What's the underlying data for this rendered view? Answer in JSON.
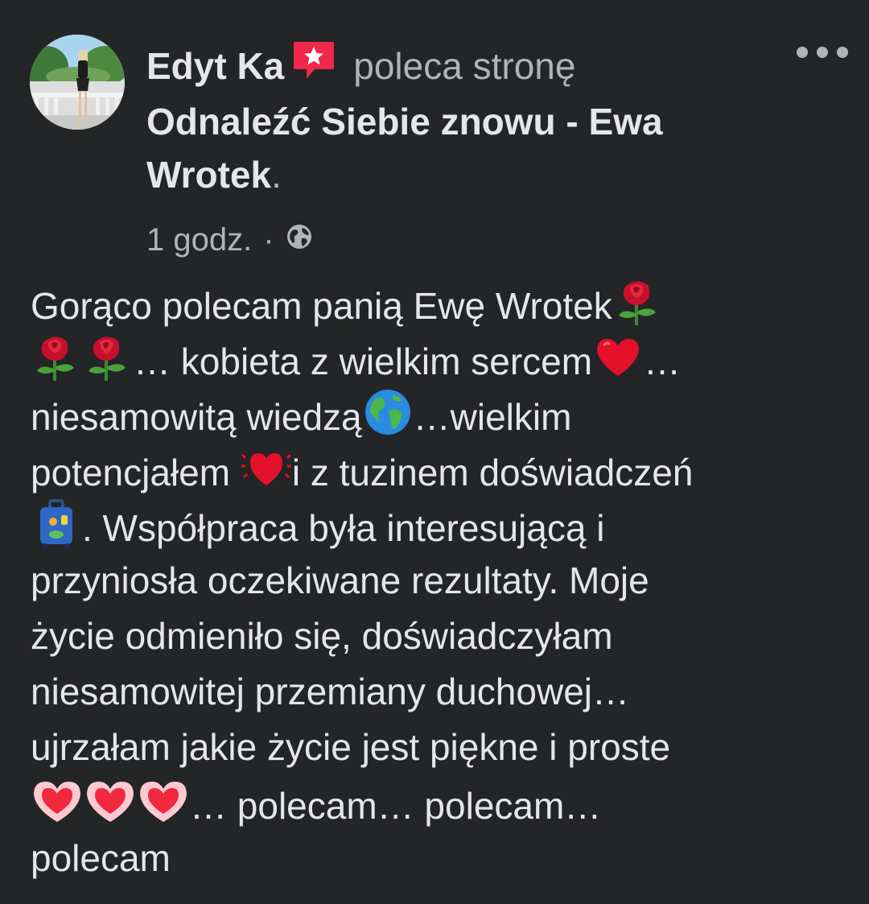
{
  "post": {
    "author": {
      "name": "Edyt Ka",
      "action": "poleca stronę"
    },
    "page": {
      "name_line1": "Odnaleźć Siebie znowu - Ewa",
      "name_line2": "Wrotek",
      "period": "."
    },
    "timestamp": "1 godz.",
    "separator": "·",
    "audience_icon": "globe-icon",
    "recommend_icon": "recommend-icon",
    "recommend_color": "#f02849",
    "background_color": "#242526",
    "text_color": "#e4e6eb",
    "secondary_color": "#b0b3b8",
    "body": {
      "l1a": "Gorąco polecam panią Ewę Wrotek",
      "l2a": "… kobieta z wielkim sercem",
      "l2b": "…",
      "l3a": "niesamowitą wiedzą",
      "l3b": "…wielkim",
      "l4a": "potencjałem ",
      "l4b": "i z tuzinem doświadczeń",
      "l5a": ". Współpraca była interesującą i",
      "l6a": "przyniosła oczekiwane rezultaty. Moje",
      "l7a": "życie odmieniło się, doświadczyłam",
      "l8a": "niesamowitej przemiany duchowej…",
      "l9a": "ujrzałam  jakie życie jest piękne i proste",
      "l10a": "… polecam… polecam…",
      "l11a": "polecam"
    },
    "emoji_names": [
      "rose-emoji",
      "red-heart-emoji",
      "globe-emoji",
      "beating-heart-emoji",
      "luggage-emoji",
      "pink-heart-emoji"
    ]
  }
}
